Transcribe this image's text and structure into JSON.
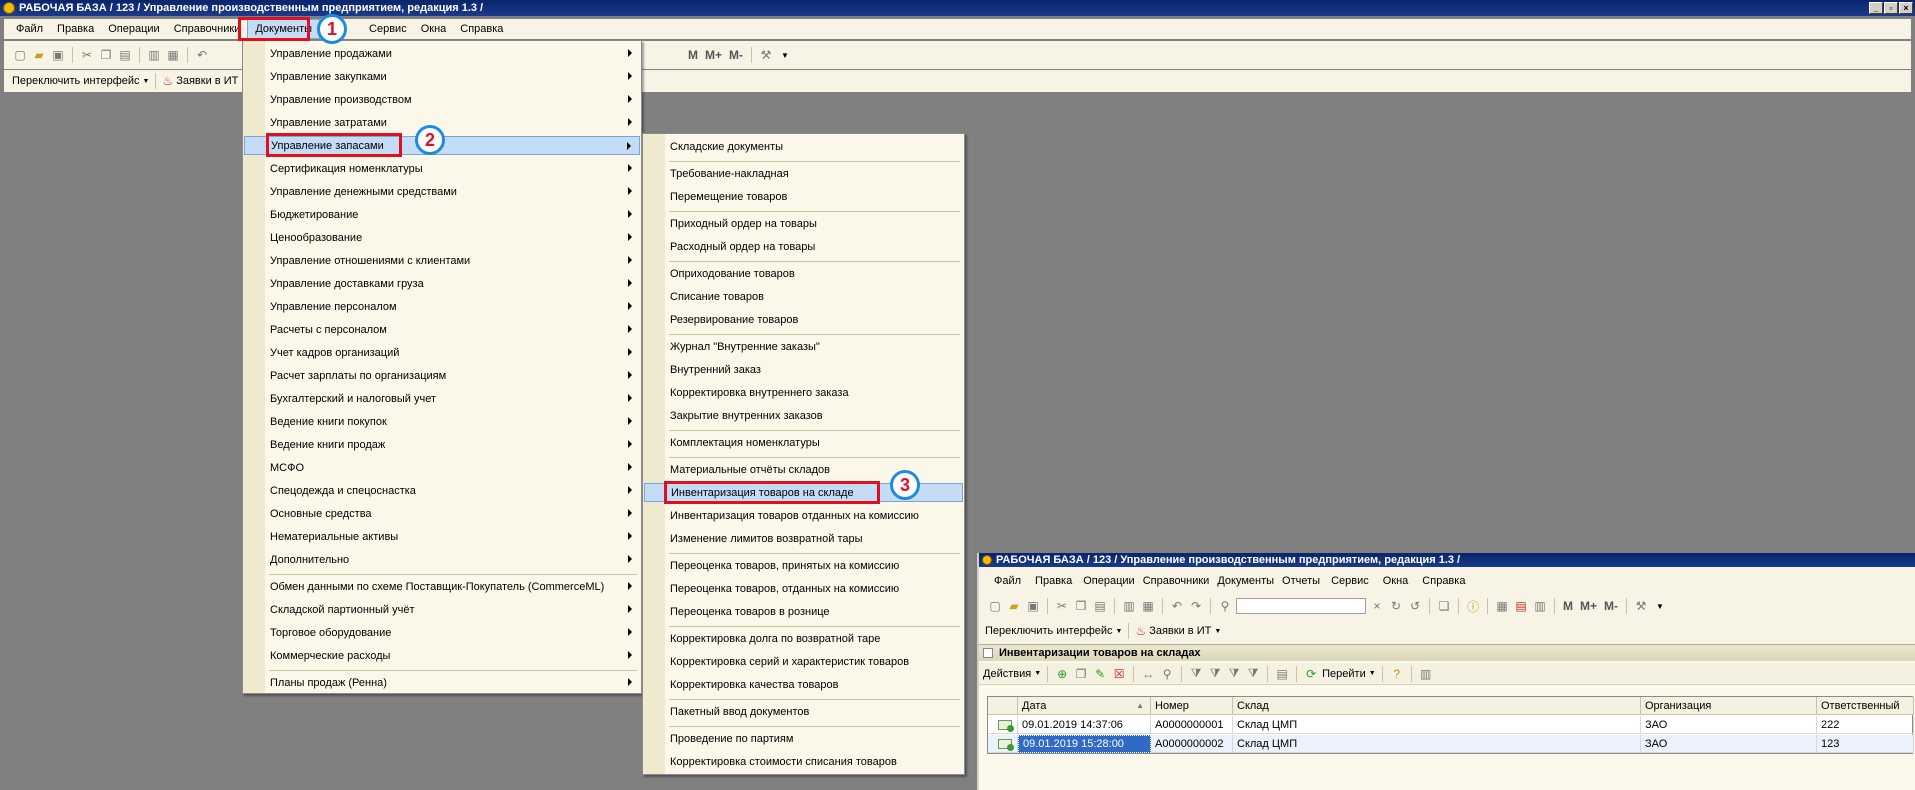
{
  "main_window": {
    "title": "РАБОЧАЯ БАЗА / 123 /  Управление производственным предприятием, редакция 1.3 /",
    "menu": [
      "Файл",
      "Правка",
      "Операции",
      "Справочники",
      "Документы",
      "Сервис",
      "Окна",
      "Справка"
    ],
    "toolbar_m": [
      "M",
      "M+",
      "M-"
    ],
    "switch_interface": "Переключить интерфейс",
    "requests_it": "Заявки в ИТ"
  },
  "documents_menu": {
    "items": [
      {
        "label": "Управление продажами",
        "submenu": true
      },
      {
        "label": "Управление закупками",
        "submenu": true
      },
      {
        "label": "Управление производством",
        "submenu": true
      },
      {
        "label": "Управление затратами",
        "submenu": true
      },
      {
        "label": "Управление запасами",
        "submenu": true,
        "highlighted": true
      },
      {
        "label": "Сертификация номенклатуры",
        "submenu": true
      },
      {
        "label": "Управление денежными средствами",
        "submenu": true
      },
      {
        "label": "Бюджетирование",
        "submenu": true
      },
      {
        "label": "Ценообразование",
        "submenu": true
      },
      {
        "label": "Управление отношениями с клиентами",
        "submenu": true
      },
      {
        "label": "Управление доставками груза",
        "submenu": true
      },
      {
        "label": "Управление персоналом",
        "submenu": true
      },
      {
        "label": "Расчеты с персоналом",
        "submenu": true
      },
      {
        "label": "Учет кадров организаций",
        "submenu": true
      },
      {
        "label": "Расчет зарплаты по организациям",
        "submenu": true
      },
      {
        "label": "Бухгалтерский и налоговый учет",
        "submenu": true
      },
      {
        "label": "Ведение книги покупок",
        "submenu": true
      },
      {
        "label": "Ведение книги продаж",
        "submenu": true
      },
      {
        "label": "МСФО",
        "submenu": true
      },
      {
        "label": "Спецодежда и спецоснастка",
        "submenu": true
      },
      {
        "label": "Основные средства",
        "submenu": true
      },
      {
        "label": "Нематериальные активы",
        "submenu": true
      },
      {
        "label": "Дополнительно",
        "submenu": true
      },
      {
        "label": "Обмен данными по схеме Поставщик-Покупатель (CommerceML)",
        "submenu": true,
        "sep_before": true
      },
      {
        "label": "Складской партионный учёт",
        "submenu": true
      },
      {
        "label": "Торговое оборудование",
        "submenu": true
      },
      {
        "label": "Коммерческие расходы",
        "submenu": true
      },
      {
        "label": "Планы продаж (Ренна)",
        "submenu": true,
        "sep_before": true
      }
    ]
  },
  "inventory_submenu": {
    "items": [
      {
        "label": "Складские документы"
      },
      {
        "label": "Требование-накладная",
        "sep_before": true
      },
      {
        "label": "Перемещение товаров"
      },
      {
        "label": "Приходный ордер на товары",
        "sep_before": true
      },
      {
        "label": "Расходный ордер на товары"
      },
      {
        "label": "Оприходование товаров",
        "sep_before": true
      },
      {
        "label": "Списание товаров"
      },
      {
        "label": "Резервирование товаров"
      },
      {
        "label": "Журнал \"Внутренние заказы\"",
        "sep_before": true
      },
      {
        "label": "Внутренний заказ"
      },
      {
        "label": "Корректировка внутреннего заказа"
      },
      {
        "label": "Закрытие внутренних заказов"
      },
      {
        "label": "Комплектация номенклатуры",
        "sep_before": true
      },
      {
        "label": "Материальные отчёты складов",
        "sep_before": true
      },
      {
        "label": "Инвентаризация товаров на складе",
        "highlighted": true
      },
      {
        "label": "Инвентаризация товаров отданных на комиссию"
      },
      {
        "label": "Изменение лимитов возвратной тары"
      },
      {
        "label": "Переоценка товаров, принятых на комиссию",
        "sep_before": true
      },
      {
        "label": "Переоценка товаров, отданных на комиссию"
      },
      {
        "label": "Переоценка товаров в рознице"
      },
      {
        "label": "Корректировка долга по возвратной таре",
        "sep_before": true
      },
      {
        "label": "Корректировка серий и характеристик товаров"
      },
      {
        "label": "Корректировка качества товаров"
      },
      {
        "label": "Пакетный ввод документов",
        "sep_before": true
      },
      {
        "label": "Проведение по партиям",
        "sep_before": true
      },
      {
        "label": "Корректировка стоимости списания товаров"
      }
    ]
  },
  "badges": [
    "1",
    "2",
    "3"
  ],
  "second_window": {
    "title": "РАБОЧАЯ БАЗА / 123 /  Управление производственным предприятием, редакция 1.3 /",
    "menu": [
      "Файл",
      "Правка",
      "Операции",
      "Справочники",
      "Документы",
      "Отчеты",
      "Сервис",
      "Окна",
      "Справка"
    ],
    "toolbar_m": [
      "M",
      "M+",
      "M-"
    ],
    "switch_interface": "Переключить интерфейс",
    "requests_it": "Заявки в ИТ",
    "list_title": "Инвентаризации товаров на складах",
    "actions_label": "Действия",
    "goto_label": "Перейти",
    "columns": [
      "Дата",
      "Номер",
      "Склад",
      "Организация",
      "Ответственный"
    ],
    "rows": [
      [
        "09.01.2019 14:37:06",
        "А0000000001",
        "Склад ЦМП",
        "ЗАО",
        "222"
      ],
      [
        "09.01.2019 15:28:00",
        "А0000000002",
        "Склад ЦМП",
        "ЗАО",
        "123"
      ]
    ]
  }
}
